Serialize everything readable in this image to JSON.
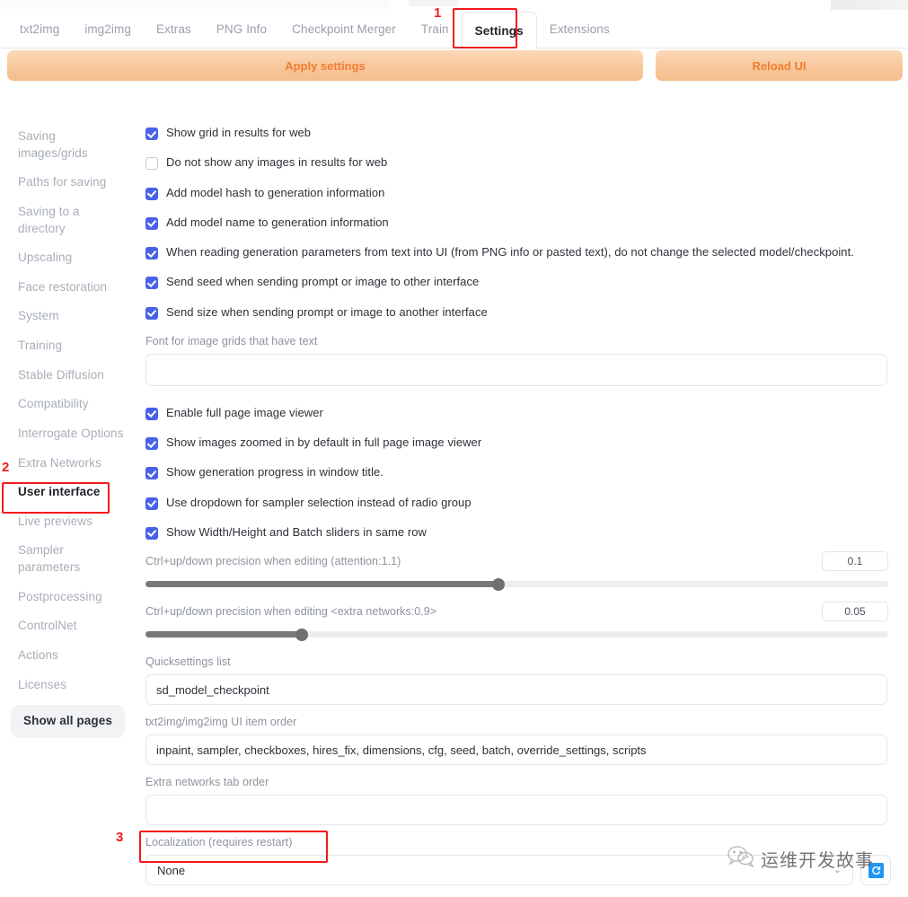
{
  "header": {
    "tabs": [
      {
        "label": "txt2img",
        "active": false
      },
      {
        "label": "img2img",
        "active": false
      },
      {
        "label": "Extras",
        "active": false
      },
      {
        "label": "PNG Info",
        "active": false
      },
      {
        "label": "Checkpoint Merger",
        "active": false
      },
      {
        "label": "Train",
        "active": false
      },
      {
        "label": "Settings",
        "active": true
      },
      {
        "label": "Extensions",
        "active": false
      }
    ],
    "apply_label": "Apply settings",
    "reload_label": "Reload UI"
  },
  "sidebar": {
    "items": [
      {
        "label": "Saving images/grids",
        "selected": false
      },
      {
        "label": "Paths for saving",
        "selected": false
      },
      {
        "label": "Saving to a directory",
        "selected": false
      },
      {
        "label": "Upscaling",
        "selected": false
      },
      {
        "label": "Face restoration",
        "selected": false
      },
      {
        "label": "System",
        "selected": false
      },
      {
        "label": "Training",
        "selected": false
      },
      {
        "label": "Stable Diffusion",
        "selected": false
      },
      {
        "label": "Compatibility",
        "selected": false
      },
      {
        "label": "Interrogate Options",
        "selected": false
      },
      {
        "label": "Extra Networks",
        "selected": false
      },
      {
        "label": "User interface",
        "selected": true
      },
      {
        "label": "Live previews",
        "selected": false
      },
      {
        "label": "Sampler parameters",
        "selected": false
      },
      {
        "label": "Postprocessing",
        "selected": false
      },
      {
        "label": "ControlNet",
        "selected": false
      },
      {
        "label": "Actions",
        "selected": false
      },
      {
        "label": "Licenses",
        "selected": false
      }
    ],
    "show_all_pages_label": "Show all pages"
  },
  "settings": {
    "checkboxes_group1": [
      {
        "label": "Show grid in results for web",
        "checked": true
      },
      {
        "label": "Do not show any images in results for web",
        "checked": false
      },
      {
        "label": "Add model hash to generation information",
        "checked": true
      },
      {
        "label": "Add model name to generation information",
        "checked": true
      },
      {
        "label": "When reading generation parameters from text into UI (from PNG info or pasted text), do not change the selected model/checkpoint.",
        "checked": true
      },
      {
        "label": "Send seed when sending prompt or image to other interface",
        "checked": true
      },
      {
        "label": "Send size when sending prompt or image to another interface",
        "checked": true
      }
    ],
    "font_field": {
      "label": "Font for image grids that have text",
      "value": "",
      "placeholder": ""
    },
    "checkboxes_group2": [
      {
        "label": "Enable full page image viewer",
        "checked": true
      },
      {
        "label": "Show images zoomed in by default in full page image viewer",
        "checked": true
      },
      {
        "label": "Show generation progress in window title.",
        "checked": true
      },
      {
        "label": "Use dropdown for sampler selection instead of radio group",
        "checked": true
      },
      {
        "label": "Show Width/Height and Batch sliders in same row",
        "checked": true
      }
    ],
    "sliders": [
      {
        "label": "Ctrl+up/down precision when editing (attention:1.1)",
        "value": "0.1",
        "percent": 47.5
      },
      {
        "label": "Ctrl+up/down precision when editing <extra networks:0.9>",
        "value": "0.05",
        "percent": 21
      }
    ],
    "text_fields": [
      {
        "label": "Quicksettings list",
        "value": "sd_model_checkpoint",
        "placeholder": ""
      },
      {
        "label": "txt2img/img2img UI item order",
        "value": "inpaint, sampler, checkboxes, hires_fix, dimensions, cfg, seed, batch, override_settings, scripts",
        "placeholder": ""
      },
      {
        "label": "Extra networks tab order",
        "value": "",
        "placeholder": ""
      }
    ],
    "localization": {
      "label": "Localization (requires restart)",
      "value": "None",
      "chevron": "chevron-down-icon",
      "refresh_icon": "refresh-icon"
    }
  },
  "annotations": [
    {
      "number": "1",
      "target": "settings-tab"
    },
    {
      "number": "2",
      "target": "sidebar-item-user-interface"
    },
    {
      "number": "3",
      "target": "localization-label"
    }
  ],
  "watermark": {
    "text": "运维开发故事",
    "logo": "wechat-icon"
  },
  "colors": {
    "accent_orange": "#f07d33",
    "checkbox_blue": "#4861e8",
    "annotation_red": "#f41a1a",
    "refresh_blue": "#2196f3"
  }
}
